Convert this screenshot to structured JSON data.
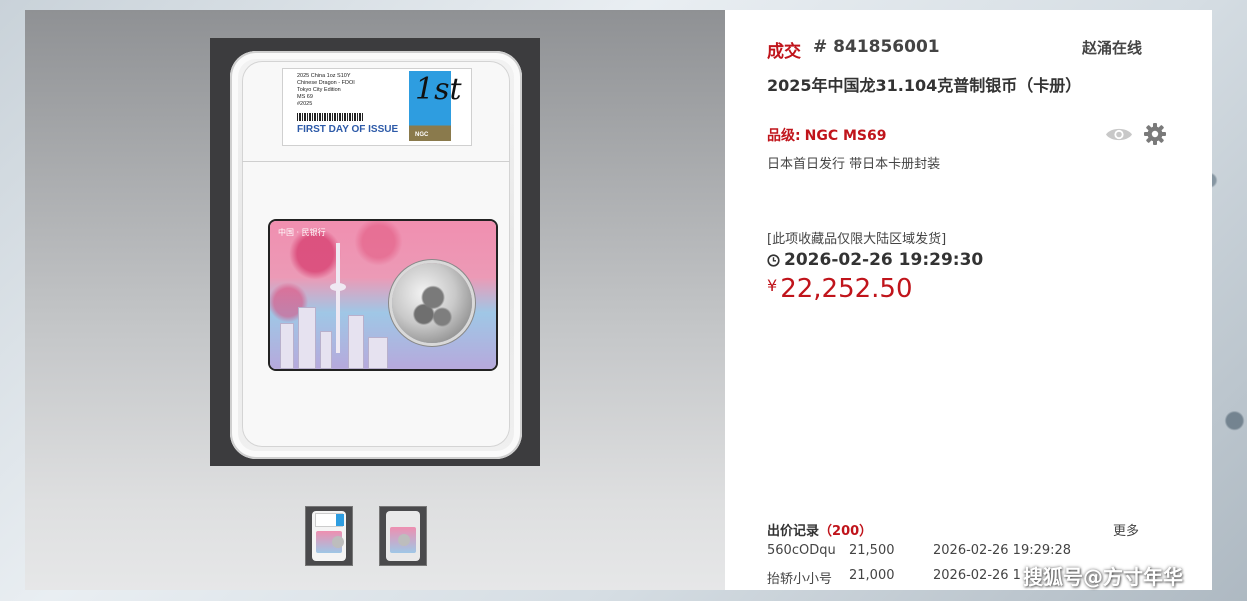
{
  "gallery": {
    "main_image": {
      "label": {
        "lines": [
          "2025 China 1oz S10Y",
          "Chinese Dragon - FDOI",
          "Tokyo City Edition",
          "MS 69",
          "#2025"
        ],
        "first_day_of_issue": "FIRST DAY OF ISSUE",
        "badge_text": "1st",
        "badge_brand": "NGC"
      },
      "card_header": "中国 · 民银行"
    },
    "thumbnails": [
      {
        "name": "thumbnail-1"
      },
      {
        "name": "thumbnail-2"
      }
    ]
  },
  "detail": {
    "status": "成交",
    "lot_number": "# 841856001",
    "seller": "赵涌在线",
    "title": "2025年中国龙31.104克普制银币（卡册）",
    "grade_label": "品级:",
    "grade_value": "NGC MS69",
    "description": "日本首日发行 带日本卡册封装",
    "notice": "[此项收藏品仅限大陆区域发货]",
    "end_time": "2026-02-26 19:29:30",
    "currency_symbol": "¥",
    "price": "22,252.50",
    "bids": {
      "header_label": "出价记录",
      "count_open": "（",
      "count": "200",
      "count_close": "）",
      "more_label": "更多",
      "rows": [
        {
          "user": "560cODqu",
          "amount": "21,500",
          "time": "2026-02-26 19:29:28"
        },
        {
          "user": "抬轿小小号",
          "amount": "21,000",
          "time": "2026-02-26 1"
        }
      ]
    }
  },
  "watermark": "搜狐号@方寸年华",
  "colors": {
    "accent_red": "#c0141b",
    "text_dark": "#333333",
    "badge_blue": "#2e9de0"
  },
  "icons": [
    "eye-icon",
    "gear-icon",
    "clock-icon"
  ]
}
